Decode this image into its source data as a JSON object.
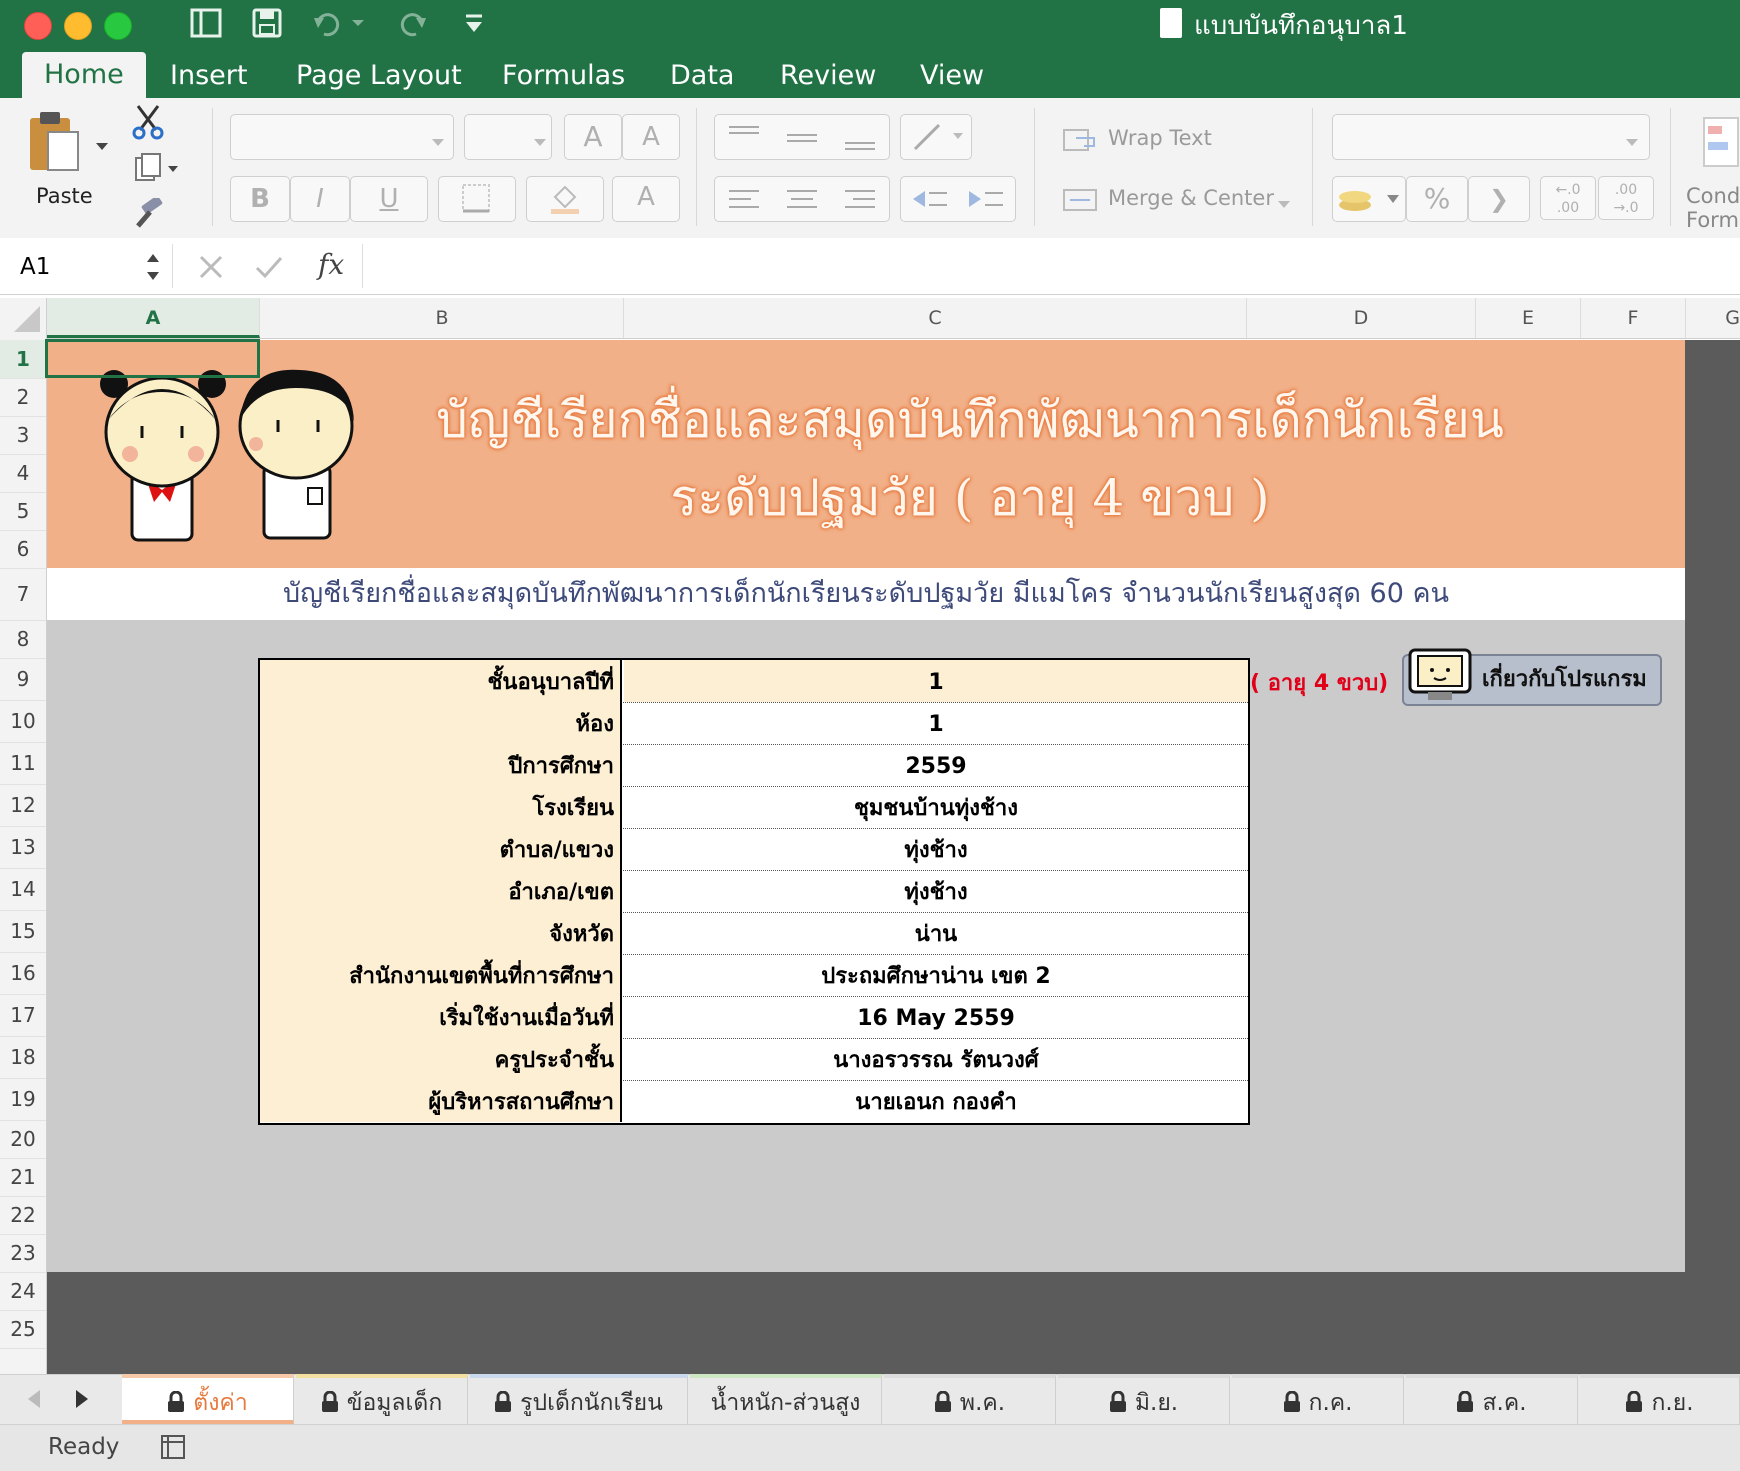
{
  "window": {
    "title": "แบบบันทึกอนุบาล1",
    "colors": {
      "excel_green": "#217346",
      "banner": "#f1b088",
      "label_bg": "#fdefd4",
      "accent_red": "#e1001a"
    }
  },
  "ribbon_tabs": [
    "Home",
    "Insert",
    "Page Layout",
    "Formulas",
    "Data",
    "Review",
    "View"
  ],
  "ribbon": {
    "paste_label": "Paste",
    "wrap_text": "Wrap Text",
    "merge_center": "Merge & Center",
    "bold": "B",
    "italic": "I",
    "underline": "U",
    "grow_font": "A",
    "shrink_font": "A",
    "font_color": "A",
    "percent": "%",
    "comma": "❯",
    "inc_decimal_top": "←.0",
    "inc_decimal_bottom": ".00",
    "dec_decimal_top": ".00",
    "dec_decimal_bottom": "→.0",
    "cond_format_1": "Condi",
    "cond_format_2": "Form"
  },
  "formula_bar": {
    "name_box": "A1",
    "fx": "fx",
    "formula": ""
  },
  "columns": [
    "A",
    "B",
    "C",
    "D",
    "E",
    "F",
    "G"
  ],
  "rows": [
    "1",
    "2",
    "3",
    "4",
    "5",
    "6",
    "7",
    "8",
    "9",
    "10",
    "11",
    "12",
    "13",
    "14",
    "15",
    "16",
    "17",
    "18",
    "19",
    "20",
    "21",
    "22",
    "23",
    "24",
    "25"
  ],
  "sheet": {
    "banner_title_line1": "บัญชีเรียกชื่อและสมุดบันทึกพัฒนาการเด็กนักเรียน",
    "banner_title_line2": "ระดับปฐมวัย ( อายุ 4 ขวบ )",
    "subtitle": "บัญชีเรียกชื่อและสมุดบันทึกพัฒนาการเด็กนักเรียนระดับปฐมวัย มีแมโคร จำนวนนักเรียนสูงสุด 60 คน",
    "age_note": "( อายุ 4 ขวบ)",
    "about_button": "เกี่ยวกับโปรแกรม",
    "info_rows": [
      {
        "label": "ชั้นอนุบาลปีที่",
        "value": "1"
      },
      {
        "label": "ห้อง",
        "value": "1"
      },
      {
        "label": "ปีการศึกษา",
        "value": "2559"
      },
      {
        "label": "โรงเรียน",
        "value": "ชุมชนบ้านทุ่งช้าง"
      },
      {
        "label": "ตำบล/แขวง",
        "value": "ทุ่งช้าง"
      },
      {
        "label": "อำเภอ/เขต",
        "value": "ทุ่งช้าง"
      },
      {
        "label": "จังหวัด",
        "value": "น่าน"
      },
      {
        "label": "สำนักงานเขตพื้นที่การศึกษา",
        "value": "ประถมศึกษาน่าน เขต 2"
      },
      {
        "label": "เริ่มใช้งานเมื่อวันที่",
        "value": "16 May 2559"
      },
      {
        "label": "ครูประจำชั้น",
        "value": "นางอรวรรณ  รัตนวงศ์"
      },
      {
        "label": "ผู้บริหารสถานศึกษา",
        "value": "นายเอนก  กองคำ"
      }
    ]
  },
  "sheet_tabs": [
    "ตั้งค่า",
    "ข้อมูลเด็ก",
    "รูปเด็กนักเรียน",
    "น้ำหนัก-ส่วนสูง",
    "พ.ค.",
    "มิ.ย.",
    "ก.ค.",
    "ส.ค.",
    "ก.ย."
  ],
  "status": {
    "ready": "Ready"
  }
}
